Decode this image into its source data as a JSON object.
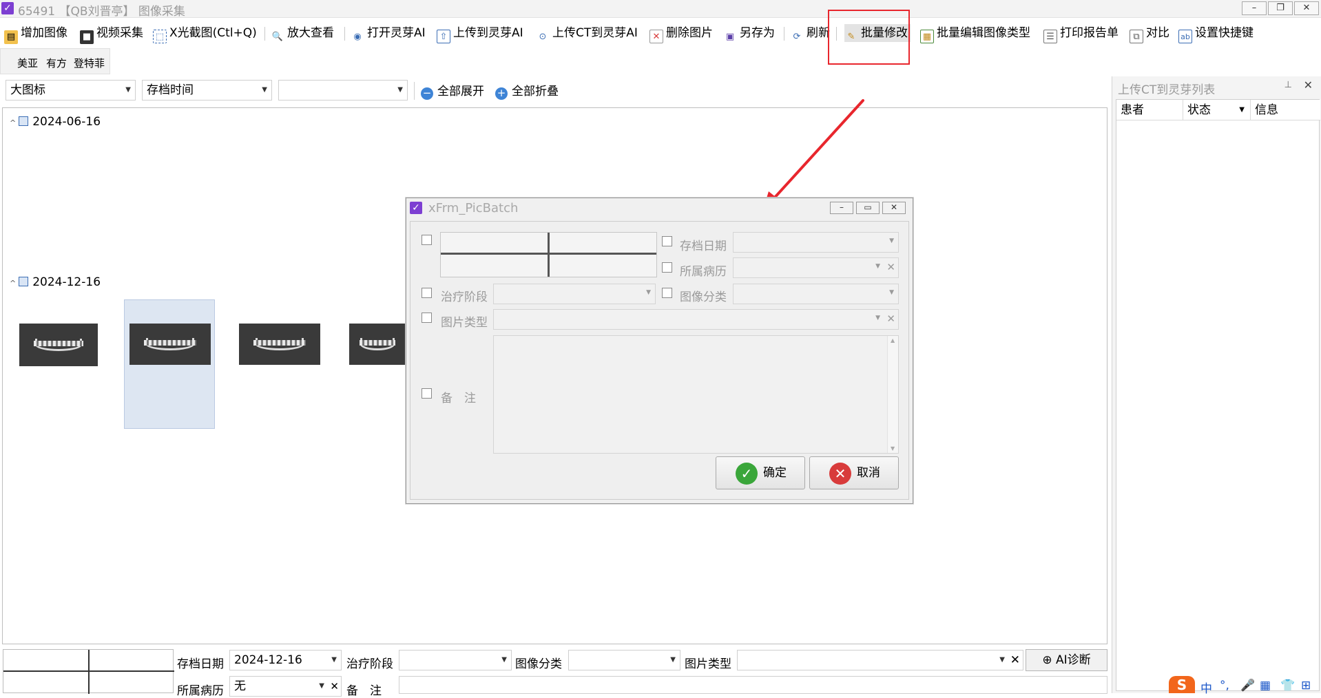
{
  "window": {
    "title": "65491 【QB刘晋亭】 图像采集",
    "buttons": {
      "minimize": "–",
      "restore": "❐",
      "close": "✕"
    }
  },
  "toolbar": {
    "add_image": "增加图像",
    "video_capture": "视频采集",
    "xray_capture": "X光截图(Ctl+Q)",
    "zoom_view": "放大查看",
    "open_lingya": "打开灵芽AI",
    "upload_lingya": "上传到灵芽AI",
    "upload_ct_lingya": "上传CT到灵芽AI",
    "delete_image": "删除图片",
    "save_as": "另存为",
    "refresh": "刷新",
    "batch_edit": "批量修改",
    "batch_edit_type": "批量编辑图像类型",
    "print_report": "打印报告单",
    "compare": "对比",
    "set_shortcut": "设置快捷键"
  },
  "group_tabs": [
    "美亚",
    "有方",
    "登特菲"
  ],
  "filter": {
    "view_mode": "大图标",
    "sort_by": "存档时间",
    "extra": "",
    "expand_all": "全部展开",
    "collapse_all": "全部折叠"
  },
  "gallery": {
    "groups": [
      {
        "date": "2024-06-16"
      },
      {
        "date": "2024-12-16"
      }
    ]
  },
  "right_panel": {
    "title": "上传CT到灵芽列表",
    "columns": [
      "患者",
      "状态",
      "信息"
    ]
  },
  "bottom": {
    "archive_date_label": "存档日期",
    "archive_date_value": "2024-12-16",
    "treatment_stage_label": "治疗阶段",
    "image_category_label": "图像分类",
    "picture_type_label": "图片类型",
    "ai_diagnosis": "AI诊断",
    "medical_record_label": "所属病历",
    "medical_record_value": "无",
    "remark_label": "备　注"
  },
  "dialog": {
    "title": "xFrm_PicBatch",
    "archive_date": "存档日期",
    "medical_record": "所属病历",
    "treatment_stage": "治疗阶段",
    "image_category": "图像分类",
    "picture_type": "图片类型",
    "remark": "备　注",
    "ok": "确定",
    "cancel": "取消"
  },
  "ime": {
    "logo": "S",
    "lang": "中",
    "punct": "°,"
  },
  "colors": {
    "highlight": "#e8262d",
    "accent_purple": "#7d3fd2",
    "ok_green": "#3aa63a",
    "cancel_red": "#d83b3b"
  }
}
